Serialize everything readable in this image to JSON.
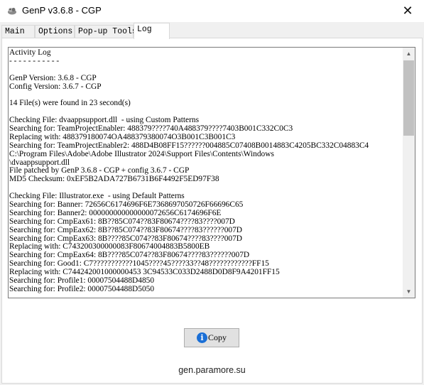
{
  "window": {
    "title": "GenP v3.6.8 - CGP",
    "close_glyph": "✕"
  },
  "tabs": [
    {
      "label": "Main",
      "active": false
    },
    {
      "label": "Options",
      "active": false
    },
    {
      "label": "Pop-up Tools",
      "active": false
    },
    {
      "label": "Log",
      "active": true
    }
  ],
  "log": {
    "lines": [
      "Activity Log",
      "- - - - - - - - - - -",
      "",
      "GenP Version: 3.6.8 - CGP",
      "Config Version: 3.6.7 - CGP",
      "",
      "14 File(s) were found in 23 second(s)",
      "",
      "Checking File: dvaappsupport.dll  - using Custom Patterns",
      "Searching for: TeamProjectEnabler: 488379????740A488379????7403B001C332C0C3",
      "Replacing with: 488379180074OA488379380074O3B001C3B001C3",
      "Searching for: TeamProjectEnabler2: 488D4B08FF15??????004885C07408B0014883C4205BC332C04883C4",
      "C:\\Program Files\\Adobe\\Adobe Illustrator 2024\\Support Files\\Contents\\Windows",
      "\\dvaappsupport.dll",
      "File patched by GenP 3.6.8 - CGP + config 3.6.7 - CGP",
      "MD5 Checksum: 0xEF5B2ADA727B6731B6F4492F5ED97F38",
      "",
      "Checking File: Illustrator.exe  - using Default Patterns",
      "Searching for: Banner: 72656C6174696F6E7368697050726F66696C65",
      "Searching for: Banner2: 000000000000000072656C6174696F6E",
      "Searching for: CmpEax61: 8B??85C074??83F80674????83????007D",
      "Searching for: CmpEax62: 8B??85C074??83F80674????83??????007D",
      "Searching for: CmpEax63: 8B????85C074??83F80674????83????007D",
      "Replacing with: C743200300000083F80674004883B5800EB",
      "Searching for: CmpEax64: 8B????85C074??83F80674????83??????007D",
      "Searching for: Good1: C7???????????1045????45????33??48????????????FF15",
      "Replacing with: C744242001000000453 3C94533C033D2488D0D8F9A4201FF15",
      "Searching for: Profile1: 00007504488D4850",
      "Searching for: Profile2: 00007504488D5050"
    ]
  },
  "scrollbar": {
    "up_glyph": "▲",
    "down_glyph": "▼",
    "position_fraction": 0.0,
    "visible_fraction": 0.3
  },
  "copy_button": {
    "icon": "info-icon",
    "icon_glyph": "i",
    "label": "Copy"
  },
  "footer": {
    "link_text": "gen.paramore.su"
  }
}
